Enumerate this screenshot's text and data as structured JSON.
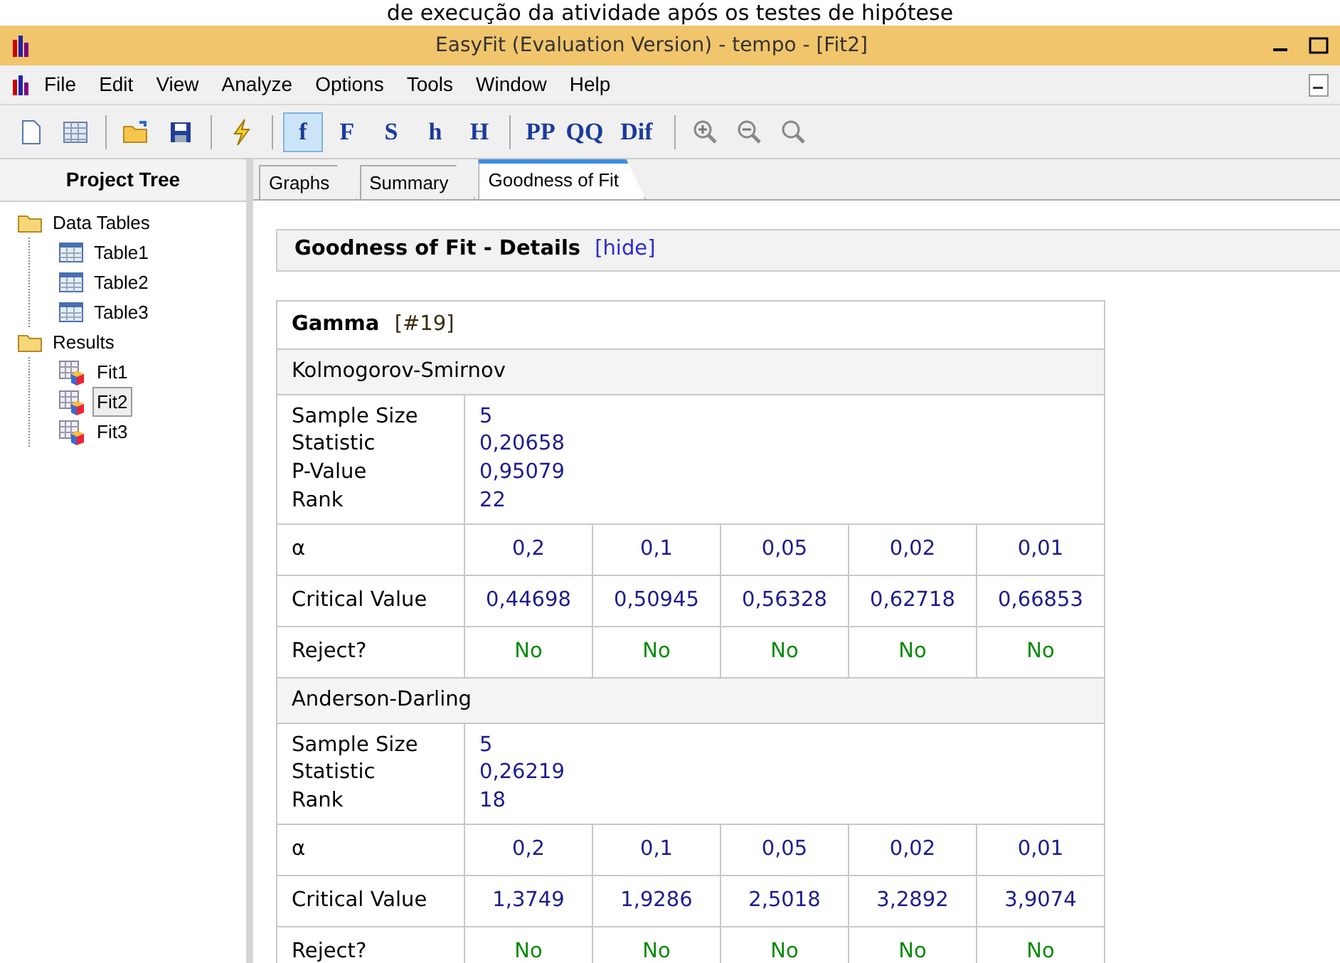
{
  "caption": "de execução da atividade após os testes de hipótese",
  "window": {
    "title": "EasyFit (Evaluation Version) - tempo - [Fit2]"
  },
  "menu": [
    "File",
    "Edit",
    "View",
    "Analyze",
    "Options",
    "Tools",
    "Window",
    "Help"
  ],
  "toolbar_text_buttons": [
    {
      "label": "f",
      "selected": true
    },
    {
      "label": "F",
      "selected": false
    },
    {
      "label": "S",
      "selected": false
    },
    {
      "label": "h",
      "selected": false
    },
    {
      "label": "H",
      "selected": false
    },
    {
      "label": "PP",
      "selected": false
    },
    {
      "label": "QQ",
      "selected": false
    },
    {
      "label": "Dif",
      "selected": false
    }
  ],
  "project_tree": {
    "title": "Project Tree",
    "items": [
      {
        "label": "Data Tables",
        "kind": "folder",
        "selected": false,
        "children": [
          {
            "label": "Table1",
            "kind": "table",
            "selected": false
          },
          {
            "label": "Table2",
            "kind": "table",
            "selected": false
          },
          {
            "label": "Table3",
            "kind": "table",
            "selected": false
          }
        ]
      },
      {
        "label": "Results",
        "kind": "folder",
        "selected": false,
        "children": [
          {
            "label": "Fit1",
            "kind": "fit",
            "selected": false
          },
          {
            "label": "Fit2",
            "kind": "fit",
            "selected": true
          },
          {
            "label": "Fit3",
            "kind": "fit",
            "selected": false
          }
        ]
      }
    ]
  },
  "tabs": [
    {
      "label": "Graphs",
      "selected": false
    },
    {
      "label": "Summary",
      "selected": false
    },
    {
      "label": "Goodness of Fit",
      "selected": true
    }
  ],
  "details": {
    "title": "Goodness of Fit - Details",
    "hide_link": "[hide]"
  },
  "result": {
    "distribution": "Gamma",
    "id": "[#19]",
    "tests": [
      {
        "name": "Kolmogorov-Smirnov",
        "stats": [
          {
            "label": "Sample Size",
            "value": "5"
          },
          {
            "label": "Statistic",
            "value": "0,20658"
          },
          {
            "label": "P-Value",
            "value": "0,95079"
          },
          {
            "label": "Rank",
            "value": "22"
          }
        ],
        "alpha_label": "α",
        "alphas": [
          "0,2",
          "0,1",
          "0,05",
          "0,02",
          "0,01"
        ],
        "critical_label": "Critical Value",
        "critical": [
          "0,44698",
          "0,50945",
          "0,56328",
          "0,62718",
          "0,66853"
        ],
        "reject_label": "Reject?",
        "reject": [
          "No",
          "No",
          "No",
          "No",
          "No"
        ]
      },
      {
        "name": "Anderson-Darling",
        "stats": [
          {
            "label": "Sample Size",
            "value": "5"
          },
          {
            "label": "Statistic",
            "value": "0,26219"
          },
          {
            "label": "Rank",
            "value": "18"
          }
        ],
        "alpha_label": "α",
        "alphas": [
          "0,2",
          "0,1",
          "0,05",
          "0,02",
          "0,01"
        ],
        "critical_label": "Critical Value",
        "critical": [
          "1,3749",
          "1,9286",
          "2,5018",
          "3,2892",
          "3,9074"
        ],
        "reject_label": "Reject?",
        "reject": [
          "No",
          "No",
          "No",
          "No",
          "No"
        ]
      }
    ]
  }
}
